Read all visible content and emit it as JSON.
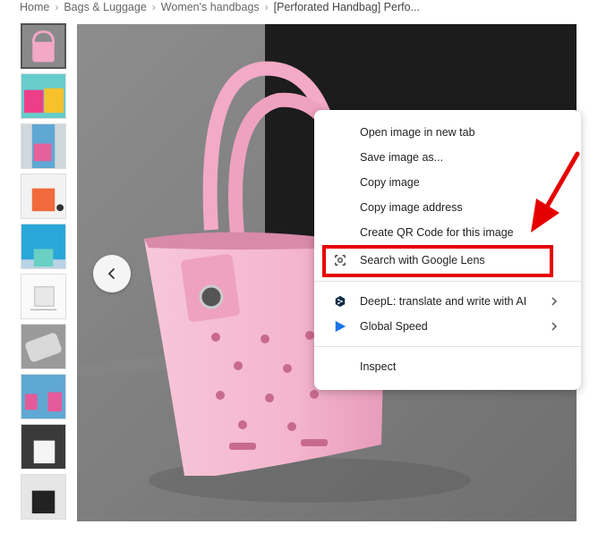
{
  "breadcrumb": {
    "items": [
      "Home",
      "Bags & Luggage",
      "Women's handbags",
      "[Perforated Handbag] Perfo..."
    ]
  },
  "thumbnails": [
    {
      "label": "pink bag",
      "color": "#f3a8c6"
    },
    {
      "label": "pink and yellow bags",
      "color": "#f6c12b"
    },
    {
      "label": "pink bag held",
      "color": "#e6609a"
    },
    {
      "label": "orange bag",
      "color": "#f06a3c"
    },
    {
      "label": "bag on model",
      "color": "#2aa7d8"
    },
    {
      "label": "bag size",
      "color": "#f4f4f4"
    },
    {
      "label": "bag detail",
      "color": "#cfcfcf"
    },
    {
      "label": "bags with model",
      "color": "#e55a9a"
    },
    {
      "label": "white bag",
      "color": "#f5f5f5"
    },
    {
      "label": "black bag",
      "color": "#222222"
    }
  ],
  "context_menu": {
    "items": [
      {
        "label": "Open image in new tab"
      },
      {
        "label": "Save image as..."
      },
      {
        "label": "Copy image"
      },
      {
        "label": "Copy image address"
      },
      {
        "label": "Create QR Code for this image"
      },
      {
        "label": "Search with Google Lens",
        "icon": "google-lens-icon"
      },
      {
        "label": "DeepL: translate and write with AI",
        "icon": "deepl-icon"
      },
      {
        "label": "Global Speed",
        "icon": "play-icon"
      },
      {
        "label": "Inspect"
      }
    ]
  },
  "colors": {
    "highlight": "#e50000",
    "bag_pink": "#f4b6ce"
  }
}
